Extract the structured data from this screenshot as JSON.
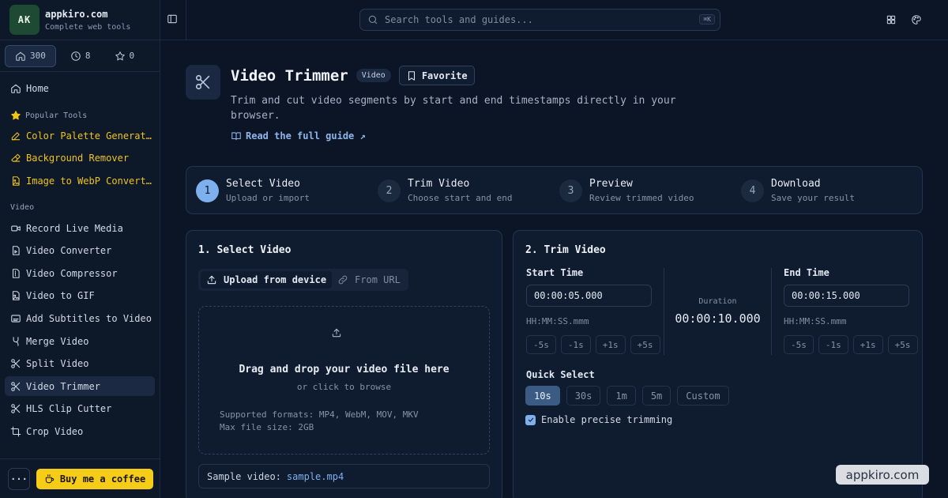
{
  "brand": {
    "logo_initials": "AK",
    "name": "appkiro.com",
    "tagline": "Complete web tools"
  },
  "stats": {
    "tools": "300",
    "recent": "8",
    "favorites": "0"
  },
  "nav": {
    "home": "Home",
    "popular_heading": "Popular Tools",
    "popular": [
      "Color Palette Generat…",
      "Background Remover",
      "Image to WebP Convert…"
    ],
    "video_heading": "Video",
    "video_items": [
      "Record Live Media",
      "Video Converter",
      "Video Compressor",
      "Video to GIF",
      "Add Subtitles to Video",
      "Merge Video",
      "Split Video",
      "Video Trimmer",
      "HLS Clip Cutter",
      "Crop Video"
    ],
    "active_item": "Video Trimmer"
  },
  "footer": {
    "more_label": "···",
    "coffee_label": "Buy me a coffee"
  },
  "search": {
    "placeholder": "Search tools and guides...",
    "shortcut": "⌘K"
  },
  "tool": {
    "title": "Video Trimmer",
    "category": "Video",
    "favorite_label": "Favorite",
    "description": "Trim and cut video segments by start and end timestamps directly in your browser.",
    "guide_label": "Read the full guide ↗"
  },
  "steps": [
    {
      "num": "1",
      "title": "Select Video",
      "sub": "Upload or import"
    },
    {
      "num": "2",
      "title": "Trim Video",
      "sub": "Choose start and end"
    },
    {
      "num": "3",
      "title": "Preview",
      "sub": "Review trimmed video"
    },
    {
      "num": "4",
      "title": "Download",
      "sub": "Save your result"
    }
  ],
  "select_card": {
    "title": "1. Select Video",
    "tab_upload": "Upload from device",
    "tab_url": "From URL",
    "drop_title": "Drag and drop your video file here",
    "drop_sub": "or click to browse",
    "formats": "Supported formats: MP4, WebM, MOV, MKV",
    "max_size": "Max file size: 2GB",
    "sample_label": "Sample video:",
    "sample_link": "sample.mp4"
  },
  "trim_card": {
    "title": "2. Trim Video",
    "start_label": "Start Time",
    "start_value": "00:00:05.000",
    "end_label": "End Time",
    "end_value": "00:00:15.000",
    "format_hint": "HH:MM:SS.mmm",
    "duration_label": "Duration",
    "duration_value": "00:00:10.000",
    "nudges": [
      "-5s",
      "-1s",
      "+1s",
      "+5s"
    ],
    "quick_label": "Quick Select",
    "quick_options": [
      "10s",
      "30s",
      "1m",
      "5m",
      "Custom"
    ],
    "quick_selected": "10s",
    "precise_label": "Enable precise trimming",
    "precise_checked": true
  },
  "watermark": "appkiro.com",
  "colors": {
    "background": "#0b1526",
    "accent": "#7fb0ee",
    "popular": "#f0c419",
    "coffee": "#f5cc17"
  }
}
